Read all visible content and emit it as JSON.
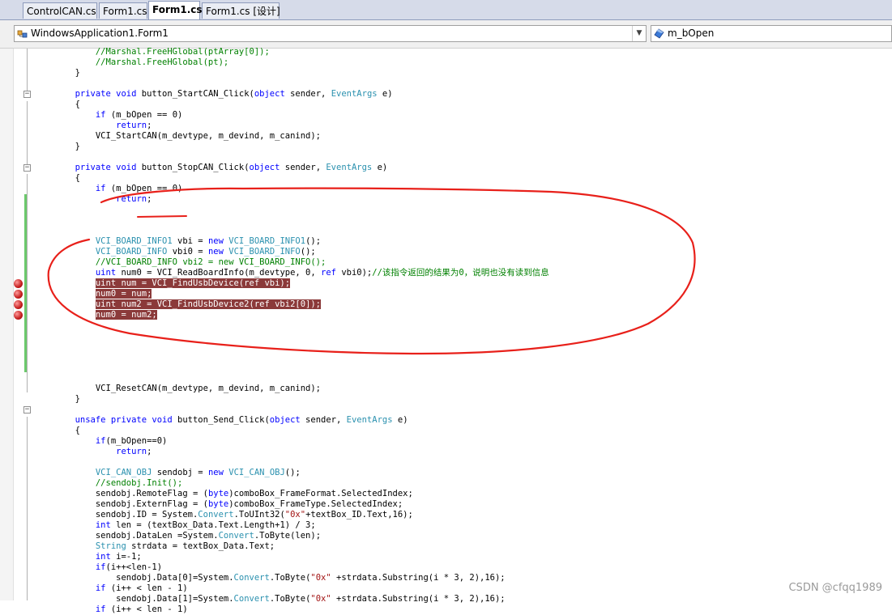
{
  "tabs": [
    {
      "label": "ControlCAN.cs",
      "active": false
    },
    {
      "label": "Form1.cs",
      "active": false
    },
    {
      "label": "Form1.cs",
      "active": true
    },
    {
      "label": "Form1.cs [设计]",
      "active": false
    }
  ],
  "navbar": {
    "class_combo": "WindowsApplication1.Form1",
    "member_combo": "m_bOpen"
  },
  "code_lines": [
    [
      {
        "t": "            //Marshal.FreeHGlobal(ptArray[0]);",
        "c": "cm"
      }
    ],
    [
      {
        "t": "            //Marshal.FreeHGlobal(pt);",
        "c": "cm"
      }
    ],
    [
      {
        "t": "        }",
        "c": ""
      }
    ],
    [],
    [
      {
        "t": "        ",
        "c": ""
      },
      {
        "t": "private void",
        "c": "kw"
      },
      {
        "t": " button_StartCAN_Click(",
        "c": ""
      },
      {
        "t": "object",
        "c": "kw"
      },
      {
        "t": " sender, ",
        "c": ""
      },
      {
        "t": "EventArgs",
        "c": "ty"
      },
      {
        "t": " e)",
        "c": ""
      }
    ],
    [
      {
        "t": "        {",
        "c": ""
      }
    ],
    [
      {
        "t": "            ",
        "c": ""
      },
      {
        "t": "if",
        "c": "kw"
      },
      {
        "t": " (m_bOpen == 0)",
        "c": ""
      }
    ],
    [
      {
        "t": "                ",
        "c": ""
      },
      {
        "t": "return",
        "c": "kw"
      },
      {
        "t": ";",
        "c": ""
      }
    ],
    [
      {
        "t": "            VCI_StartCAN(m_devtype, m_devind, m_canind);",
        "c": ""
      }
    ],
    [
      {
        "t": "        }",
        "c": ""
      }
    ],
    [],
    [
      {
        "t": "        ",
        "c": ""
      },
      {
        "t": "private void",
        "c": "kw"
      },
      {
        "t": " button_StopCAN_Click(",
        "c": ""
      },
      {
        "t": "object",
        "c": "kw"
      },
      {
        "t": " sender, ",
        "c": ""
      },
      {
        "t": "EventArgs",
        "c": "ty"
      },
      {
        "t": " e)",
        "c": ""
      }
    ],
    [
      {
        "t": "        {",
        "c": ""
      }
    ],
    [
      {
        "t": "            ",
        "c": ""
      },
      {
        "t": "if",
        "c": "kw"
      },
      {
        "t": " (m_bOpen == 0)",
        "c": ""
      }
    ],
    [
      {
        "t": "                ",
        "c": ""
      },
      {
        "t": "return",
        "c": "kw"
      },
      {
        "t": ";",
        "c": ""
      }
    ],
    [],
    [],
    [],
    [
      {
        "t": "            ",
        "c": ""
      },
      {
        "t": "VCI_BOARD_INFO1",
        "c": "ty"
      },
      {
        "t": " vbi = ",
        "c": ""
      },
      {
        "t": "new",
        "c": "kw"
      },
      {
        "t": " ",
        "c": ""
      },
      {
        "t": "VCI_BOARD_INFO1",
        "c": "ty"
      },
      {
        "t": "();",
        "c": ""
      }
    ],
    [
      {
        "t": "            ",
        "c": ""
      },
      {
        "t": "VCI_BOARD_INFO",
        "c": "ty"
      },
      {
        "t": " vbi0 = ",
        "c": ""
      },
      {
        "t": "new",
        "c": "kw"
      },
      {
        "t": " ",
        "c": ""
      },
      {
        "t": "VCI_BOARD_INFO",
        "c": "ty"
      },
      {
        "t": "();",
        "c": ""
      }
    ],
    [
      {
        "t": "            //VCI_BOARD_INFO vbi2 = new VCI_BOARD_INFO();",
        "c": "cm"
      }
    ],
    [
      {
        "t": "            ",
        "c": ""
      },
      {
        "t": "uint",
        "c": "kw"
      },
      {
        "t": " num0 = VCI_ReadBoardInfo(m_devtype, 0, ",
        "c": ""
      },
      {
        "t": "ref",
        "c": "kw"
      },
      {
        "t": " vbi0);",
        "c": ""
      },
      {
        "t": "//该指令返回的结果为0，说明也没有读到信息",
        "c": "cm"
      }
    ],
    [
      {
        "t": "            ",
        "c": ""
      },
      {
        "t": "uint num = VCI_FindUsbDevice(ref vbi);",
        "c": "hl"
      }
    ],
    [
      {
        "t": "            ",
        "c": ""
      },
      {
        "t": "num0 = num;",
        "c": "hl"
      }
    ],
    [
      {
        "t": "            ",
        "c": ""
      },
      {
        "t": "uint num2 = VCI_FindUsbDevice2(ref vbi2[0]);",
        "c": "hl"
      }
    ],
    [
      {
        "t": "            ",
        "c": ""
      },
      {
        "t": "num0 = num2;",
        "c": "hl"
      }
    ],
    [],
    [],
    [],
    [],
    [],
    [],
    [
      {
        "t": "            VCI_ResetCAN(m_devtype, m_devind, m_canind);",
        "c": ""
      }
    ],
    [
      {
        "t": "        }",
        "c": ""
      }
    ],
    [],
    [
      {
        "t": "        ",
        "c": ""
      },
      {
        "t": "unsafe private void",
        "c": "kw"
      },
      {
        "t": " button_Send_Click(",
        "c": ""
      },
      {
        "t": "object",
        "c": "kw"
      },
      {
        "t": " sender, ",
        "c": ""
      },
      {
        "t": "EventArgs",
        "c": "ty"
      },
      {
        "t": " e)",
        "c": ""
      }
    ],
    [
      {
        "t": "        {",
        "c": ""
      }
    ],
    [
      {
        "t": "            ",
        "c": ""
      },
      {
        "t": "if",
        "c": "kw"
      },
      {
        "t": "(m_bOpen==0)",
        "c": ""
      }
    ],
    [
      {
        "t": "                ",
        "c": ""
      },
      {
        "t": "return",
        "c": "kw"
      },
      {
        "t": ";",
        "c": ""
      }
    ],
    [],
    [
      {
        "t": "            ",
        "c": ""
      },
      {
        "t": "VCI_CAN_OBJ",
        "c": "ty"
      },
      {
        "t": " sendobj = ",
        "c": ""
      },
      {
        "t": "new",
        "c": "kw"
      },
      {
        "t": " ",
        "c": ""
      },
      {
        "t": "VCI_CAN_OBJ",
        "c": "ty"
      },
      {
        "t": "();",
        "c": ""
      }
    ],
    [
      {
        "t": "            //sendobj.Init();",
        "c": "cm"
      }
    ],
    [
      {
        "t": "            sendobj.RemoteFlag = (",
        "c": ""
      },
      {
        "t": "byte",
        "c": "kw"
      },
      {
        "t": ")comboBox_FrameFormat.SelectedIndex;",
        "c": ""
      }
    ],
    [
      {
        "t": "            sendobj.ExternFlag = (",
        "c": ""
      },
      {
        "t": "byte",
        "c": "kw"
      },
      {
        "t": ")comboBox_FrameType.SelectedIndex;",
        "c": ""
      }
    ],
    [
      {
        "t": "            sendobj.ID = System.",
        "c": ""
      },
      {
        "t": "Convert",
        "c": "ty"
      },
      {
        "t": ".ToUInt32(",
        "c": ""
      },
      {
        "t": "\"0x\"",
        "c": "st"
      },
      {
        "t": "+textBox_ID.Text,16);",
        "c": ""
      }
    ],
    [
      {
        "t": "            ",
        "c": ""
      },
      {
        "t": "int",
        "c": "kw"
      },
      {
        "t": " len = (textBox_Data.Text.Length+1) / 3;",
        "c": ""
      }
    ],
    [
      {
        "t": "            sendobj.DataLen =System.",
        "c": ""
      },
      {
        "t": "Convert",
        "c": "ty"
      },
      {
        "t": ".ToByte(len);",
        "c": ""
      }
    ],
    [
      {
        "t": "            ",
        "c": ""
      },
      {
        "t": "String",
        "c": "ty"
      },
      {
        "t": " strdata = textBox_Data.Text;",
        "c": ""
      }
    ],
    [
      {
        "t": "            ",
        "c": ""
      },
      {
        "t": "int",
        "c": "kw"
      },
      {
        "t": " i=-1;",
        "c": ""
      }
    ],
    [
      {
        "t": "            ",
        "c": ""
      },
      {
        "t": "if",
        "c": "kw"
      },
      {
        "t": "(i++<len-1)",
        "c": ""
      }
    ],
    [
      {
        "t": "                sendobj.Data[0]=System.",
        "c": ""
      },
      {
        "t": "Convert",
        "c": "ty"
      },
      {
        "t": ".ToByte(",
        "c": ""
      },
      {
        "t": "\"0x\"",
        "c": "st"
      },
      {
        "t": " +strdata.Substring(i * 3, 2),16);",
        "c": ""
      }
    ],
    [
      {
        "t": "            ",
        "c": ""
      },
      {
        "t": "if",
        "c": "kw"
      },
      {
        "t": " (i++ < len - 1)",
        "c": ""
      }
    ],
    [
      {
        "t": "                sendobj.Data[1]=System.",
        "c": ""
      },
      {
        "t": "Convert",
        "c": "ty"
      },
      {
        "t": ".ToByte(",
        "c": ""
      },
      {
        "t": "\"0x\"",
        "c": "st"
      },
      {
        "t": " +strdata.Substring(i * 3, 2),16);",
        "c": ""
      }
    ],
    [
      {
        "t": "            ",
        "c": ""
      },
      {
        "t": "if",
        "c": "kw"
      },
      {
        "t": " (i++ < len - 1)",
        "c": ""
      }
    ]
  ],
  "breakpoint_lines": [
    22,
    23,
    24,
    25
  ],
  "watermark": "CSDN @cfqq1989",
  "colors": {
    "keyword": "#0000ff",
    "type": "#2b91af",
    "comment": "#008000",
    "string": "#a31515",
    "selection": "#8b3a3a",
    "annotation_ink": "#e8201a"
  }
}
